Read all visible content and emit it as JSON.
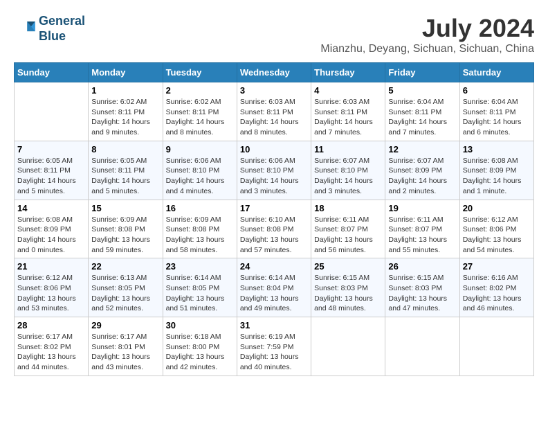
{
  "header": {
    "logo_line1": "General",
    "logo_line2": "Blue",
    "month_year": "July 2024",
    "location": "Mianzhu, Deyang, Sichuan, Sichuan, China"
  },
  "days_of_week": [
    "Sunday",
    "Monday",
    "Tuesday",
    "Wednesday",
    "Thursday",
    "Friday",
    "Saturday"
  ],
  "weeks": [
    [
      {
        "day": "",
        "info": ""
      },
      {
        "day": "1",
        "info": "Sunrise: 6:02 AM\nSunset: 8:11 PM\nDaylight: 14 hours\nand 9 minutes."
      },
      {
        "day": "2",
        "info": "Sunrise: 6:02 AM\nSunset: 8:11 PM\nDaylight: 14 hours\nand 8 minutes."
      },
      {
        "day": "3",
        "info": "Sunrise: 6:03 AM\nSunset: 8:11 PM\nDaylight: 14 hours\nand 8 minutes."
      },
      {
        "day": "4",
        "info": "Sunrise: 6:03 AM\nSunset: 8:11 PM\nDaylight: 14 hours\nand 7 minutes."
      },
      {
        "day": "5",
        "info": "Sunrise: 6:04 AM\nSunset: 8:11 PM\nDaylight: 14 hours\nand 7 minutes."
      },
      {
        "day": "6",
        "info": "Sunrise: 6:04 AM\nSunset: 8:11 PM\nDaylight: 14 hours\nand 6 minutes."
      }
    ],
    [
      {
        "day": "7",
        "info": "Sunrise: 6:05 AM\nSunset: 8:11 PM\nDaylight: 14 hours\nand 5 minutes."
      },
      {
        "day": "8",
        "info": "Sunrise: 6:05 AM\nSunset: 8:11 PM\nDaylight: 14 hours\nand 5 minutes."
      },
      {
        "day": "9",
        "info": "Sunrise: 6:06 AM\nSunset: 8:10 PM\nDaylight: 14 hours\nand 4 minutes."
      },
      {
        "day": "10",
        "info": "Sunrise: 6:06 AM\nSunset: 8:10 PM\nDaylight: 14 hours\nand 3 minutes."
      },
      {
        "day": "11",
        "info": "Sunrise: 6:07 AM\nSunset: 8:10 PM\nDaylight: 14 hours\nand 3 minutes."
      },
      {
        "day": "12",
        "info": "Sunrise: 6:07 AM\nSunset: 8:09 PM\nDaylight: 14 hours\nand 2 minutes."
      },
      {
        "day": "13",
        "info": "Sunrise: 6:08 AM\nSunset: 8:09 PM\nDaylight: 14 hours\nand 1 minute."
      }
    ],
    [
      {
        "day": "14",
        "info": "Sunrise: 6:08 AM\nSunset: 8:09 PM\nDaylight: 14 hours\nand 0 minutes."
      },
      {
        "day": "15",
        "info": "Sunrise: 6:09 AM\nSunset: 8:08 PM\nDaylight: 13 hours\nand 59 minutes."
      },
      {
        "day": "16",
        "info": "Sunrise: 6:09 AM\nSunset: 8:08 PM\nDaylight: 13 hours\nand 58 minutes."
      },
      {
        "day": "17",
        "info": "Sunrise: 6:10 AM\nSunset: 8:08 PM\nDaylight: 13 hours\nand 57 minutes."
      },
      {
        "day": "18",
        "info": "Sunrise: 6:11 AM\nSunset: 8:07 PM\nDaylight: 13 hours\nand 56 minutes."
      },
      {
        "day": "19",
        "info": "Sunrise: 6:11 AM\nSunset: 8:07 PM\nDaylight: 13 hours\nand 55 minutes."
      },
      {
        "day": "20",
        "info": "Sunrise: 6:12 AM\nSunset: 8:06 PM\nDaylight: 13 hours\nand 54 minutes."
      }
    ],
    [
      {
        "day": "21",
        "info": "Sunrise: 6:12 AM\nSunset: 8:06 PM\nDaylight: 13 hours\nand 53 minutes."
      },
      {
        "day": "22",
        "info": "Sunrise: 6:13 AM\nSunset: 8:05 PM\nDaylight: 13 hours\nand 52 minutes."
      },
      {
        "day": "23",
        "info": "Sunrise: 6:14 AM\nSunset: 8:05 PM\nDaylight: 13 hours\nand 51 minutes."
      },
      {
        "day": "24",
        "info": "Sunrise: 6:14 AM\nSunset: 8:04 PM\nDaylight: 13 hours\nand 49 minutes."
      },
      {
        "day": "25",
        "info": "Sunrise: 6:15 AM\nSunset: 8:03 PM\nDaylight: 13 hours\nand 48 minutes."
      },
      {
        "day": "26",
        "info": "Sunrise: 6:15 AM\nSunset: 8:03 PM\nDaylight: 13 hours\nand 47 minutes."
      },
      {
        "day": "27",
        "info": "Sunrise: 6:16 AM\nSunset: 8:02 PM\nDaylight: 13 hours\nand 46 minutes."
      }
    ],
    [
      {
        "day": "28",
        "info": "Sunrise: 6:17 AM\nSunset: 8:02 PM\nDaylight: 13 hours\nand 44 minutes."
      },
      {
        "day": "29",
        "info": "Sunrise: 6:17 AM\nSunset: 8:01 PM\nDaylight: 13 hours\nand 43 minutes."
      },
      {
        "day": "30",
        "info": "Sunrise: 6:18 AM\nSunset: 8:00 PM\nDaylight: 13 hours\nand 42 minutes."
      },
      {
        "day": "31",
        "info": "Sunrise: 6:19 AM\nSunset: 7:59 PM\nDaylight: 13 hours\nand 40 minutes."
      },
      {
        "day": "",
        "info": ""
      },
      {
        "day": "",
        "info": ""
      },
      {
        "day": "",
        "info": ""
      }
    ]
  ]
}
